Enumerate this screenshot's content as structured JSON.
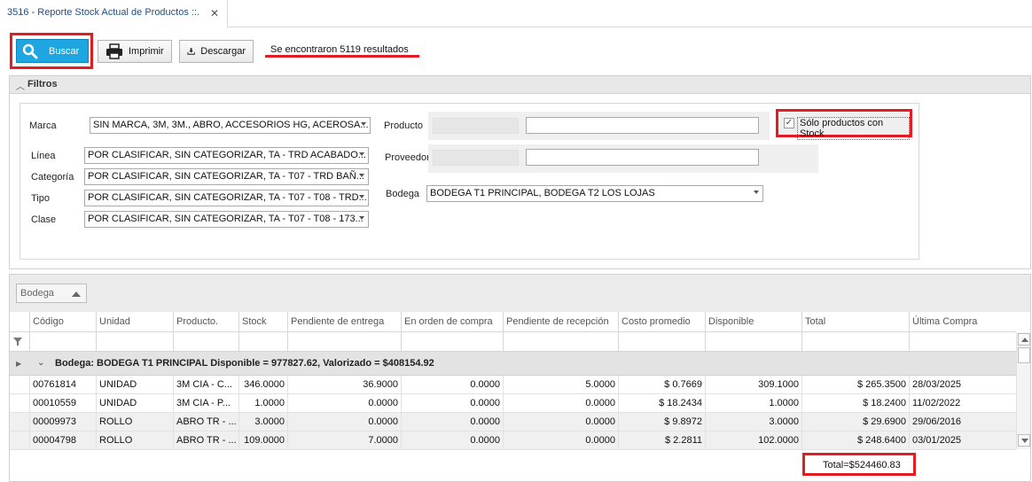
{
  "tab": {
    "title": "3516 - Reporte Stock Actual de Productos ::.",
    "close": "✕"
  },
  "toolbar": {
    "buscar": "Buscar",
    "imprimir": "Imprimir",
    "descargar": "Descargar",
    "results": "Se encontraron 5119 resultados"
  },
  "filters": {
    "title": "Filtros",
    "marca_label": "Marca",
    "marca_value": "SIN MARCA, 3M, 3M., ABRO, ACCESORIOS HG, ACEROSA...",
    "linea_label": "Línea",
    "linea_value": "POR CLASIFICAR, SIN CATEGORIZAR, TA - TRD ACABADO...",
    "categoria_label": "Categoría",
    "categoria_value": "POR CLASIFICAR, SIN CATEGORIZAR, TA - T07 - TRD BAÑ...",
    "tipo_label": "Tipo",
    "tipo_value": "POR CLASIFICAR, SIN CATEGORIZAR, TA - T07 - T08 - TRD...",
    "clase_label": "Clase",
    "clase_value": "POR CLASIFICAR, SIN CATEGORIZAR, TA - T07 - T08 - 173...",
    "producto_label": "Producto",
    "proveedor_label": "Proveedor",
    "bodega_label": "Bodega",
    "bodega_value": "BODEGA T1  PRINCIPAL, BODEGA T2  LOS LOJAS",
    "solo_stock_label": "Sólo productos con Stock",
    "solo_stock_checked": true
  },
  "grid": {
    "group_chip": "Bodega",
    "columns": [
      "Código",
      "Unidad",
      "Producto.",
      "Stock",
      "Pendiente de entrega",
      "En orden de compra",
      "Pendiente de recepción",
      "Costo promedio",
      "Disponible",
      "Total",
      "Última Compra"
    ],
    "group_row": "Bodega: BODEGA T1  PRINCIPAL Disponible = 977827.62, Valorizado = $408154.92",
    "rows": [
      [
        "00761814",
        "UNIDAD",
        "3M CIA  - C...",
        "346.0000",
        "36.9000",
        "0.0000",
        "5.0000",
        "$ 0.7669",
        "309.1000",
        "$ 265.3500",
        "28/03/2025"
      ],
      [
        "00010559",
        "UNIDAD",
        "3M CIA  - P...",
        "1.0000",
        "0.0000",
        "0.0000",
        "0.0000",
        "$ 18.2434",
        "1.0000",
        "$ 18.2400",
        "11/02/2022"
      ],
      [
        "00009973",
        "ROLLO",
        "ABRO TR - ...",
        "3.0000",
        "0.0000",
        "0.0000",
        "0.0000",
        "$ 9.8972",
        "3.0000",
        "$ 29.6900",
        "29/06/2016"
      ],
      [
        "00004798",
        "ROLLO",
        "ABRO TR - ...",
        "109.0000",
        "7.0000",
        "0.0000",
        "0.0000",
        "$ 2.2811",
        "102.0000",
        "$ 248.6400",
        "03/01/2025"
      ]
    ],
    "total": "Total=$524460.83"
  },
  "colors": {
    "accent": "#1da6df",
    "highlight": "#e31b23"
  }
}
